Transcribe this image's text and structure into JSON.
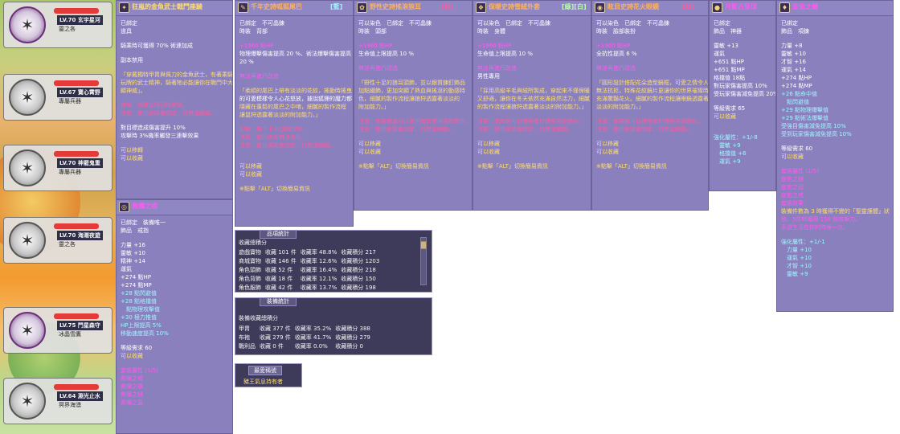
{
  "pets": [
    {
      "lv": "LV.70 玄宇星河",
      "cls": "靈之各"
    },
    {
      "lv": "LV.67 寶心霄野",
      "cls": "專屬兵器"
    },
    {
      "lv": "LV.70 神罷鬼重",
      "cls": "專屬兵器"
    },
    {
      "lv": "LV.70 海潮夜遊",
      "cls": "靈之各"
    },
    {
      "lv": "LV.75 門星森守",
      "cls": "冰晶雪鷹"
    },
    {
      "lv": "LV.64 淵光止水",
      "cls": "冥界海湧"
    }
  ],
  "tip1": {
    "title": "狂嵐的金魚武士戰鬥座騎",
    "lines": [
      "已綁定",
      "道具",
      "",
      "騎乘時可獲得 70% 術連加成",
      "",
      "副本禁用",
      "",
      "「穿戴獨特甲胄與佩刀的金魚武士，有著乘騎",
      "玩牌的武士精神，騎著牠必能讓你在戰鬥中大",
      "顯神威」。",
      "",
      "使用：領取金鏈召喚座騎。",
      "注意：使用後將會綁定，且無法解綁。",
      "",
      "對目標造成傷害提升 10%",
      "攻擊時 3%機率觸發三連擊效果",
      "",
      "可以移轉",
      "可以收藏"
    ]
  },
  "tip2": {
    "title": "救贖之戒",
    "lines": [
      "已綁定　裝備唯一",
      "飾品　戒指",
      "",
      "力量 +16",
      "靈敏 +10",
      "精神 +14",
      "運氣",
      "+274 點HP",
      "+274 點MP",
      "+28 點閃避值",
      "+28 點格擋值",
      "　點物理攻擊值",
      "+30 極力推值",
      "HP上限提高 5%",
      "移動速度提高 10%",
      "",
      "等級需求 60",
      "可以收藏",
      "",
      "套裝屬性 (1/5)",
      "救贖之戒",
      "救贖之環",
      "救贖之鏈",
      "救贖之盔"
    ]
  },
  "tip3": {
    "title": "千年史詩呱狐尾巴",
    "tag": "[藍]",
    "lines": [
      "已綁定　不可晶鍊",
      "時裝　背部",
      "",
      "+1960 點HP",
      "物理爆擊傷害提高 20 %、術法爆擊傷害提高",
      "20 %",
      "",
      "無法再進行改造",
      "",
      "「柔順的尾巴上帶有淡淡的花紋，搖動時搖曳",
      "的可愛模樣令人心花怒放，據說狐狸的魔力都",
      "隱藏在蓬鬆的尾巴之中唷，細膩的製作流程",
      "讓鼠狩透露著淡淡的附加能力。」",
      "",
      "切換：按下 F 可切換型態。",
      "注意：使用後將無法染色。",
      "注意：使用後將會綁定，且無法解綁。",
      "",
      "",
      "可以移藏",
      "可以收藏",
      "",
      "※點擊「ALT」切換簡易資訊"
    ]
  },
  "tip4": {
    "title": "野性史詩搖滾狼耳",
    "tag": "[紅]",
    "lines": [
      "可以染色　已綁定　不可晶鍊",
      "時裝　頭部",
      "",
      "+1960 點HP",
      "生命值上限提高 10 %",
      "",
      "無法再進行改造",
      "",
      "「野性十足的狼耳頭飾，並以銀質鍊釘飾品",
      "加點綴飾，更加突顯了熱血與搖滾的動感特",
      "色，細膩的製作流程讓狼狩透露著淡淡的",
      "附加能力。」",
      "",
      "注意：本裝備處可以使用者於使用染劑變色。",
      "注意：使用後將會綁定，且無法解綁。",
      "",
      "可以移藏",
      "可以收藏",
      "",
      "※點擊「ALT」切換簡易資訊"
    ]
  },
  "tip5": {
    "title": "保暖史詩雪絨外套",
    "tag": "[綠][白]",
    "lines": [
      "可以染色　已綁定　不可晶鍊",
      "時裝　身體",
      "",
      "+1960 點HP",
      "生命值上限提高 10 %",
      "",
      "無法再進行改造",
      "男性專用",
      "",
      "「採用高級羊毛與絨所製成，穿起來不僅保暖",
      "又舒適，讓你在冬天依然充滿自然活力，細膩",
      "的製作流程讓狼狩透露著淡淡的附加能力。」",
      "",
      "注意：本時裝可以使用者於使用染劑變色。",
      "注意：使用後將會綁定，且無法解綁。",
      "",
      "可以移藏",
      "可以收藏",
      "",
      "※點擊「ALT」切換簡易資訊"
    ]
  },
  "tip6": {
    "title": "眩目史詩花火眼鏡",
    "tag": "[紅]",
    "lines": [
      "可以染色　已綁定　不可晶鍊",
      "時裝　臉部裝扮",
      "",
      "+1960 點HP",
      "全抗性提高 6 %",
      "",
      "無法再進行改造",
      "",
      "「圓形設計搭配花朵造型鏡框，可愛之情令人",
      "無法抗拒，特殊花紋鏡片更讓你的世界璀璨時",
      "充滿驚豔花火。細膩的製作流程讓眼鏡透露著",
      "淡淡的附加能力。」",
      "",
      "注意：本時裝可以使用者於使用染劑變色。",
      "注意：使用後將會綁定，且無法解綁。",
      "",
      "可以移藏",
      "可以收藏",
      "",
      "※點擊「ALT」切換簡易資訊"
    ]
  },
  "tip7": {
    "title": "月影古星球",
    "lines": [
      "已綁定",
      "飾品　神器",
      "",
      "靈敏 +13",
      "運氣",
      "+651 點HP",
      "+651 點MP",
      "格擋值 18點",
      "對玩家傷害提高 10%",
      "受玩家傷害減免提高 20%",
      "",
      "等級需求 65",
      "可以收藏",
      "",
      "",
      "強化屬性：+1/-8",
      "　靈敏 +9",
      "　格擋值 +6",
      "　運氣 +9"
    ]
  },
  "tip8": {
    "title": "庇佑之鏈",
    "lines": [
      "已綁定",
      "飾品　項鍊",
      "",
      "力量 +8",
      "靈敏 +10",
      "才智 +16",
      "運氣 +14",
      "+274 點HP",
      "+274 點MP",
      "+26 點命中值",
      "　點閃避值",
      "+29 點物理爆擊值",
      "+29 點術法爆擊值",
      "受強目傷害減免提高 10%",
      "受到玩家傷害減免提高 10%",
      "",
      "等級需求 60",
      "可以收藏",
      "",
      "套裝屬性 (1/5)",
      "庇佑之鏈",
      "庇佑之冠",
      "庇佑之戒",
      "套裝效果：",
      "裝備件數為 3 時獲得不變的「聖靈護體」狀",
      "態。5件時獲得 150 點攻擊力。",
      "永遠生活在你的時候一次。",
      "",
      "強化屬性：+1/-1",
      "　力量 +10",
      "　運氣 +10",
      "　才智 +10",
      "　靈敏 +9"
    ]
  },
  "stat1": {
    "tab": "品項統計",
    "title": "收藏總積分",
    "rows": [
      [
        "遊戲寶物",
        "收藏 101 件",
        "收藏率 48.8%",
        "收藏積分 217"
      ],
      [
        "商城寶物",
        "收藏 146 件",
        "收藏率 12.6%",
        "收藏積分 1203"
      ],
      [
        "角色頭飾",
        "收藏 52 件",
        "收藏率 16.4%",
        "收藏積分 218"
      ],
      [
        "角色背飾",
        "收藏 18 件",
        "收藏率 12.1%",
        "收藏積分 150"
      ],
      [
        "角色服飾",
        "收藏 42 件",
        "收藏率 13.7%",
        "收藏積分 198"
      ]
    ]
  },
  "stat2": {
    "tab": "裝備統計",
    "title": "裝備收藏總積分",
    "rows": [
      [
        "甲胄",
        "收藏 377 件",
        "收藏率 35.2%",
        "收藏積分 388"
      ],
      [
        "布袍",
        "收藏 279 件",
        "收藏率 41.7%",
        "收藏積分 279"
      ],
      [
        "戰利品",
        "收藏 0 件",
        "收藏率 0.0%",
        "收藏積分 0"
      ]
    ]
  },
  "fav": {
    "title": "最愛稱號",
    "value": "豬王氣息持有者"
  }
}
